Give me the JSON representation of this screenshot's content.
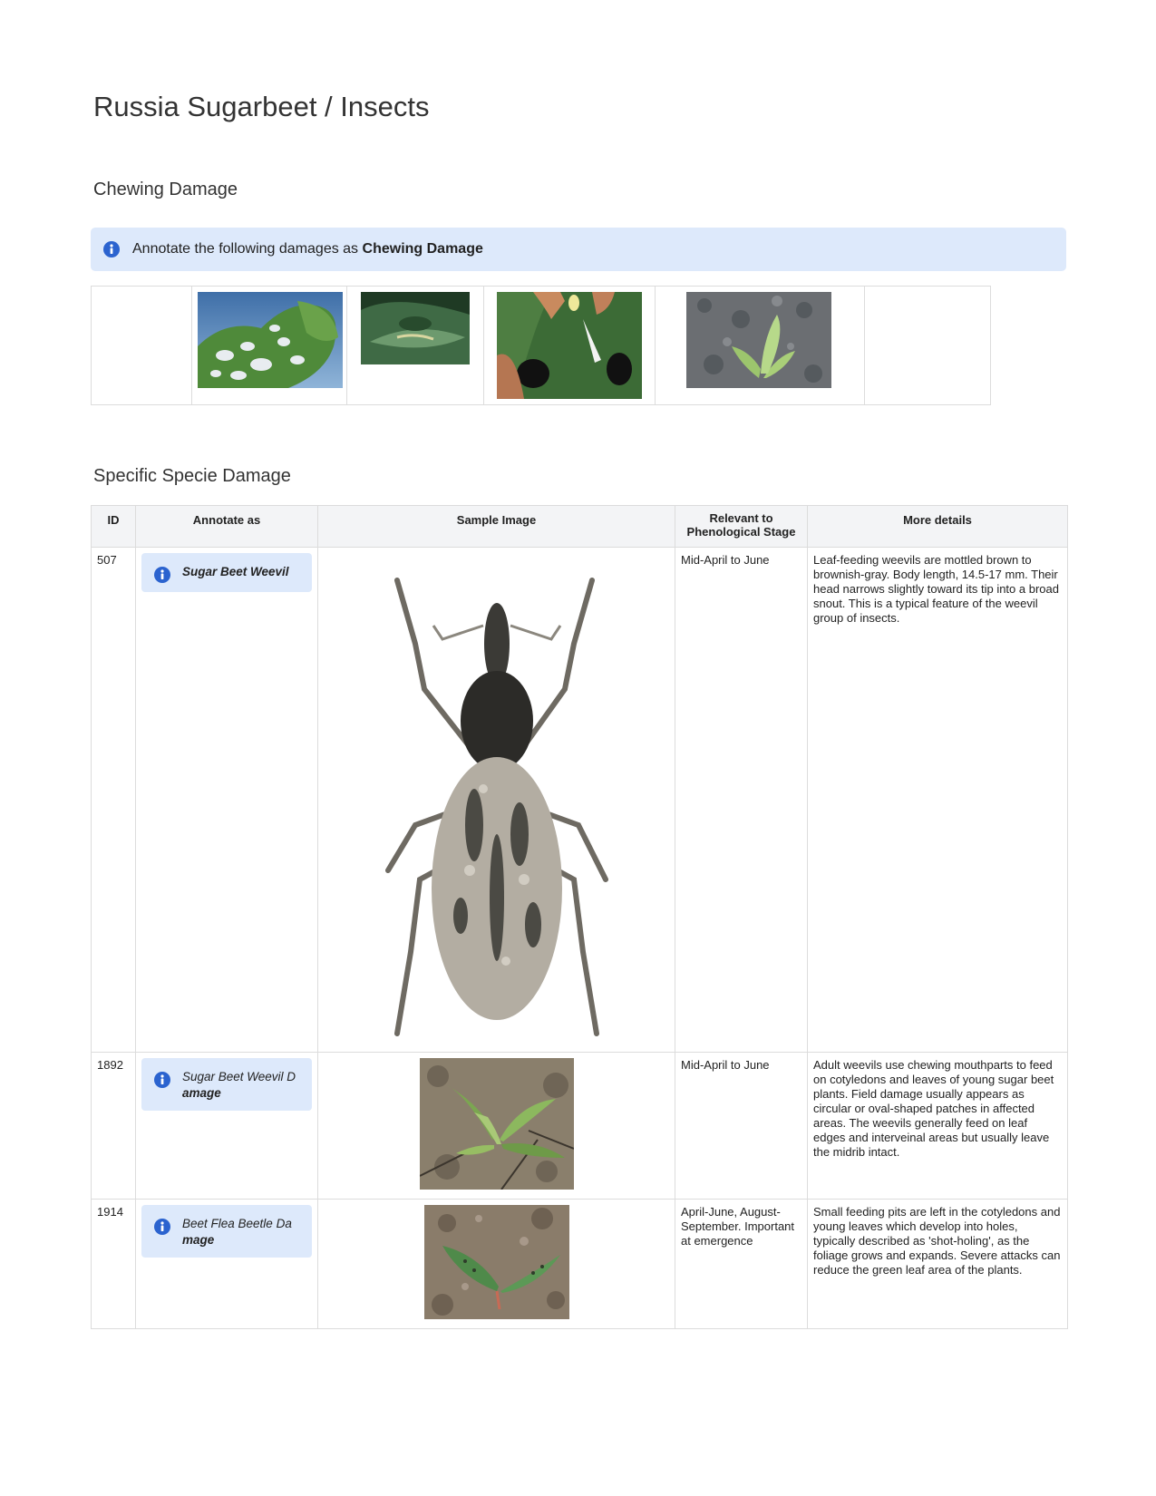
{
  "page": {
    "title": "Russia Sugarbeet / Insects"
  },
  "chewing": {
    "heading": "Chewing Damage",
    "notice_prefix": "Annotate the following damages as",
    "notice_strong": "Chewing Damage",
    "thumbnails": [
      {
        "icon": "beet-leaf-holes-photo"
      },
      {
        "icon": "leaf-chewing-photo"
      },
      {
        "icon": "hand-leaf-larva-photo"
      },
      {
        "icon": "seedling-soil-photo"
      }
    ]
  },
  "specific": {
    "heading": "Specific Specie Damage",
    "columns": {
      "id": "ID",
      "annotate": "Annotate as",
      "sample": "Sample Image",
      "stage": "Relevant to Phenological Stage",
      "details": "More details"
    },
    "rows": [
      {
        "id": "507",
        "annotate_a": "Sugar Beet Weevil",
        "annotate_b": "",
        "stage": "Mid-April to June",
        "details": "Leaf-feeding weevils are mottled brown to brownish-gray. Body length, 14.5-17 mm. Their head narrows slightly toward its tip into a broad snout. This is a typical feature of the weevil group of insects."
      },
      {
        "id": "1892",
        "annotate_a": "Sugar Beet Weevil D",
        "annotate_b": "amage",
        "stage": "Mid-April to June",
        "details": "Adult weevils use chewing mouthparts to feed on cotyledons and leaves of young sugar beet plants. Field damage usually appears as circular or oval-shaped patches in affected areas. The weevils generally feed on leaf edges and interveinal areas but usually leave the midrib intact."
      },
      {
        "id": "1914",
        "annotate_a": "Beet Flea Beetle Da",
        "annotate_b": "mage",
        "stage": "April-June, August-September. Important at emergence",
        "details": "Small feeding pits are left in the cotyledons and young leaves which develop into holes, typically described as 'shot-holing', as the foliage grows and expands. Severe attacks can reduce the green leaf area of the plants."
      }
    ]
  }
}
